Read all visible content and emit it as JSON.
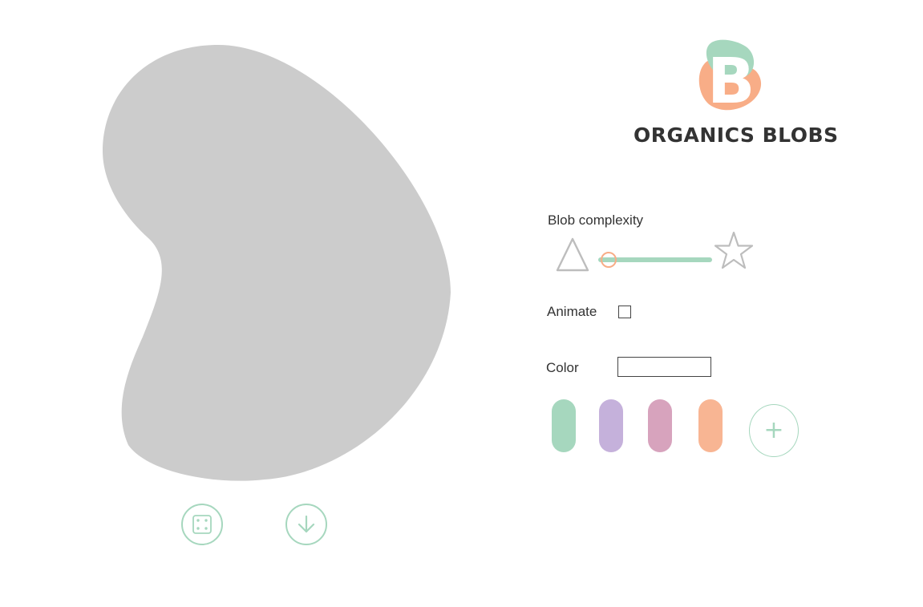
{
  "brand": {
    "title": "ORGANICS BLOBS",
    "logo_letter": "B",
    "logo_colors": {
      "back": "#f8ad87",
      "front": "#a6d7be",
      "letter": "#ffffff"
    }
  },
  "blob": {
    "color": "#cccccc"
  },
  "actions": {
    "randomize_icon": "dice-icon",
    "download_icon": "download-arrow-icon",
    "accent": "#a6d7be"
  },
  "controls": {
    "complexity": {
      "label": "Blob complexity",
      "min_icon": "triangle-icon",
      "max_icon": "star-icon",
      "value": 0.09
    },
    "animate": {
      "label": "Animate",
      "checked": false
    },
    "color": {
      "label": "Color",
      "value": "#ffffff"
    }
  },
  "palette": [
    {
      "name": "green",
      "color": "#a6d7be"
    },
    {
      "name": "lavender",
      "color": "#c5b1db"
    },
    {
      "name": "mauve",
      "color": "#d7a3bd"
    },
    {
      "name": "peach",
      "color": "#f8b593"
    }
  ],
  "add_color": {
    "label": "+"
  }
}
